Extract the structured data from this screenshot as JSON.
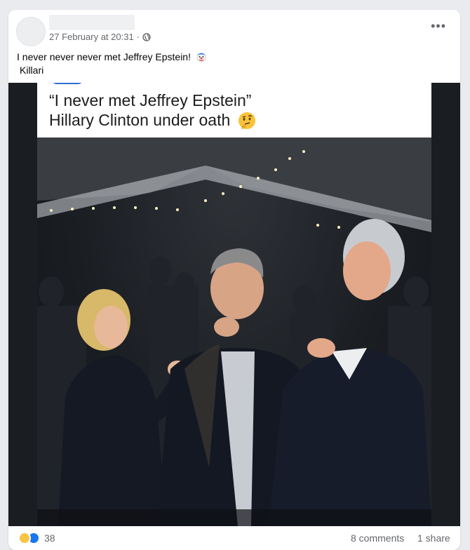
{
  "post": {
    "timestamp": "27 February at 20:31",
    "separator": "·",
    "privacy_icon": "globe-icon",
    "more_icon": "more-options-icon",
    "caption_line1": "I never never never met Jeffrey Epstein!",
    "caption_emoji": "clown-face-icon",
    "caption_line2": "Killari"
  },
  "image": {
    "quote_line1": "“I never met Jeffrey Epstein”",
    "quote_line2": "Hillary Clinton under oath",
    "quote_emoji": "thinking-face-icon"
  },
  "footer": {
    "reaction_icons": [
      "haha-reaction-icon",
      "like-reaction-icon"
    ],
    "reaction_count": "38",
    "comments": "8 comments",
    "shares": "1 share"
  },
  "colors": {
    "background": "#e9ebee",
    "card": "#ffffff",
    "secondary_text": "#65676b",
    "like_blue": "#1877f2",
    "haha_yellow": "#f7c544"
  }
}
